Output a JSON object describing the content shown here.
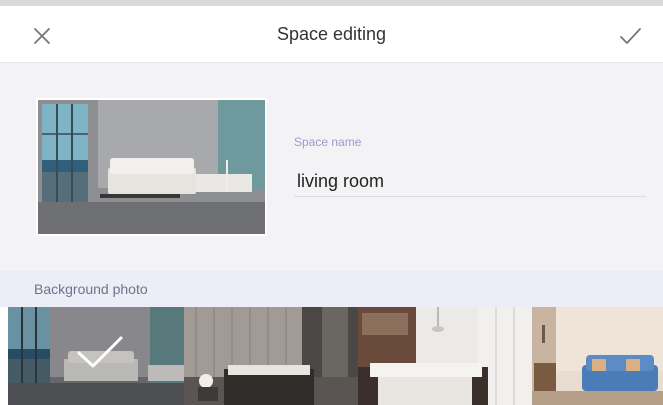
{
  "header": {
    "title": "Space editing",
    "close_icon": "close-icon",
    "confirm_icon": "checkmark-icon"
  },
  "space": {
    "name_label": "Space name",
    "name_value": "living room",
    "preview_image": "living-room-photo"
  },
  "background": {
    "section_label": "Background photo",
    "options": [
      {
        "image": "living-room-photo",
        "selected": true
      },
      {
        "image": "bedroom-photo",
        "selected": false
      },
      {
        "image": "kitchen-photo",
        "selected": false
      },
      {
        "image": "lounge-sofa-photo",
        "selected": false
      }
    ]
  },
  "colors": {
    "accent_label": "#9a9acb",
    "section_bg": "#ecedf6"
  }
}
